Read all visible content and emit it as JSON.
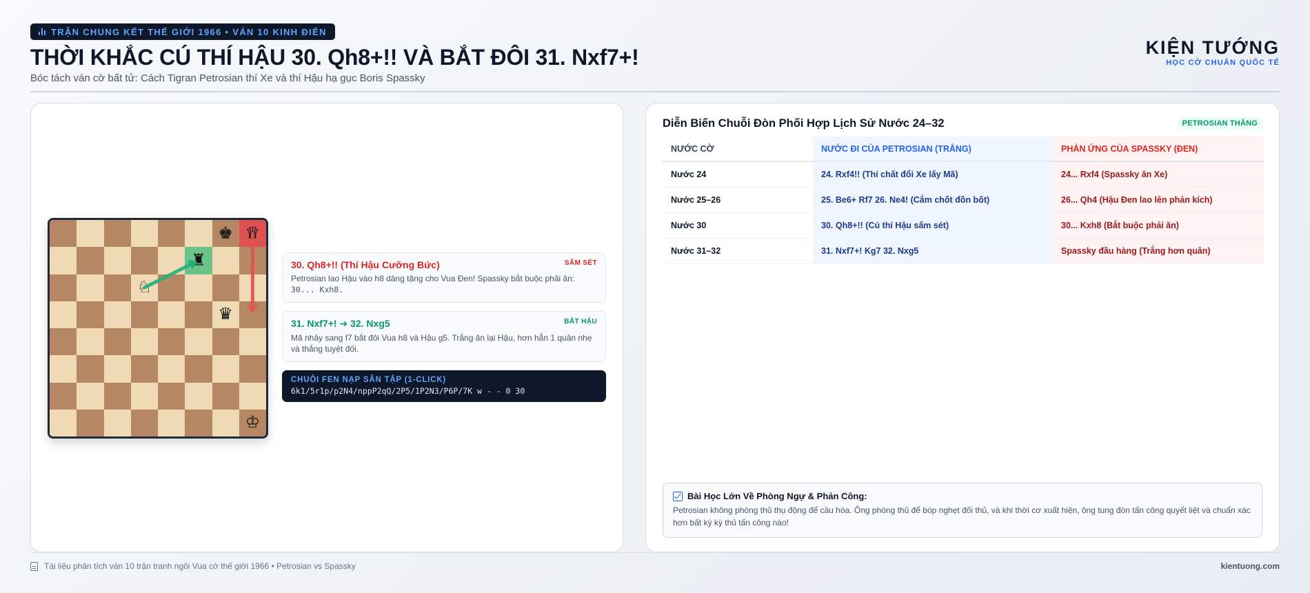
{
  "header": {
    "badge": "TRẬN CHUNG KẾT THẾ GIỚI 1966 • VÁN 10 KINH ĐIỂN",
    "title": "THỜI KHẮC CÚ THÍ HẬU 30. Qh8+!! VÀ BẮT ĐÔI 31. Nxf7+!",
    "subtitle": "Bóc tách ván cờ bất tử: Cách Tigran Petrosian thí Xe và thí Hậu hạ gục Boris Spassky",
    "brand_name": "KIỆN TƯỚNG",
    "brand_tagline": "HỌC CỜ CHUẨN QUỐC TẾ"
  },
  "board": {
    "pieces": [
      {
        "square": "g8",
        "glyph": "♚"
      },
      {
        "square": "h8",
        "glyph": "♛"
      },
      {
        "square": "f7",
        "glyph": "♜"
      },
      {
        "square": "d6",
        "glyph": "♘"
      },
      {
        "square": "g5",
        "glyph": "♛"
      },
      {
        "square": "h1",
        "glyph": "♔"
      }
    ],
    "highlights": [
      {
        "square": "h8",
        "color": "#e05252"
      },
      {
        "square": "f7",
        "color": "#6cc38a"
      }
    ],
    "arrows": [
      {
        "from": "h8",
        "to": "h5",
        "color": "#e05252"
      },
      {
        "from": "d6",
        "to": "f7",
        "color": "#22b07d"
      }
    ]
  },
  "notes": [
    {
      "title": "30. Qh8+!! (Thí Hậu Cưỡng Bức)",
      "tag": "SẤM SÉT",
      "color": "#dc2626",
      "body": "Petrosian lao Hậu vào h8 dâng tặng cho Vua Đen! Spassky bắt buộc phải ăn:",
      "code": "30... Kxh8."
    },
    {
      "title": "31. Nxf7+! ➔ 32. Nxg5",
      "tag": "BẮT HẬU",
      "color": "#059669",
      "body": "Mã nhảy sang f7 bắt đôi Vua h8 và Hậu g5. Trắng ăn lại Hậu, hơn hẳn 1 quân nhẹ và thắng tuyệt đối."
    }
  ],
  "fen": {
    "label": "CHUỖI FEN NẠP SẴN TẬP (1-CLICK)",
    "value": "6k1/5r1p/p2N4/nppP2qQ/2P5/1P2N3/P6P/7K w - - 0 30"
  },
  "moves_panel": {
    "title": "Diễn Biến Chuỗi Đòn Phối Hợp Lịch Sử Nước 24–32",
    "pill": "PETROSIAN THẮNG",
    "columns": [
      "NƯỚC CỜ",
      "NƯỚC ĐI CỦA PETROSIAN (TRẮNG)",
      "PHẢN ỨNG CỦA SPASSKY (ĐEN)"
    ],
    "rows": [
      [
        "Nước 24",
        "24. Rxf4!! (Thí chất đổi Xe lấy Mã)",
        "24... Rxf4 (Spassky ăn Xe)"
      ],
      [
        "Nước 25–26",
        "25. Be6+ Rf7 26. Ne4! (Cắm chốt đồn bốt)",
        "26... Qh4 (Hậu Đen lao lên phản kích)"
      ],
      [
        "Nước 30",
        "30. Qh8+!! (Cú thí Hậu sấm sét)",
        "30... Kxh8 (Bắt buộc phải ăn)"
      ],
      [
        "Nước 31–32",
        "31. Nxf7+! Kg7 32. Nxg5",
        "Spassky đầu hàng (Trắng hơn quân)"
      ]
    ]
  },
  "lesson": {
    "title": "Bài Học Lớn Về Phòng Ngự & Phản Công:",
    "body": "Petrosian không phòng thủ thụ động để cầu hòa. Ông phòng thủ để bóp nghẹt đối thủ, và khi thời cơ xuất hiện, ông tung đòn tấn công quyết liệt và chuẩn xác hơn bất kỳ kỳ thủ tấn công nào!"
  },
  "footer": {
    "left": "Tài liệu phân tích ván 10 trận tranh ngôi Vua cờ thế giới 1966 • Petrosian vs Spassky",
    "right": "kientuong.com"
  }
}
